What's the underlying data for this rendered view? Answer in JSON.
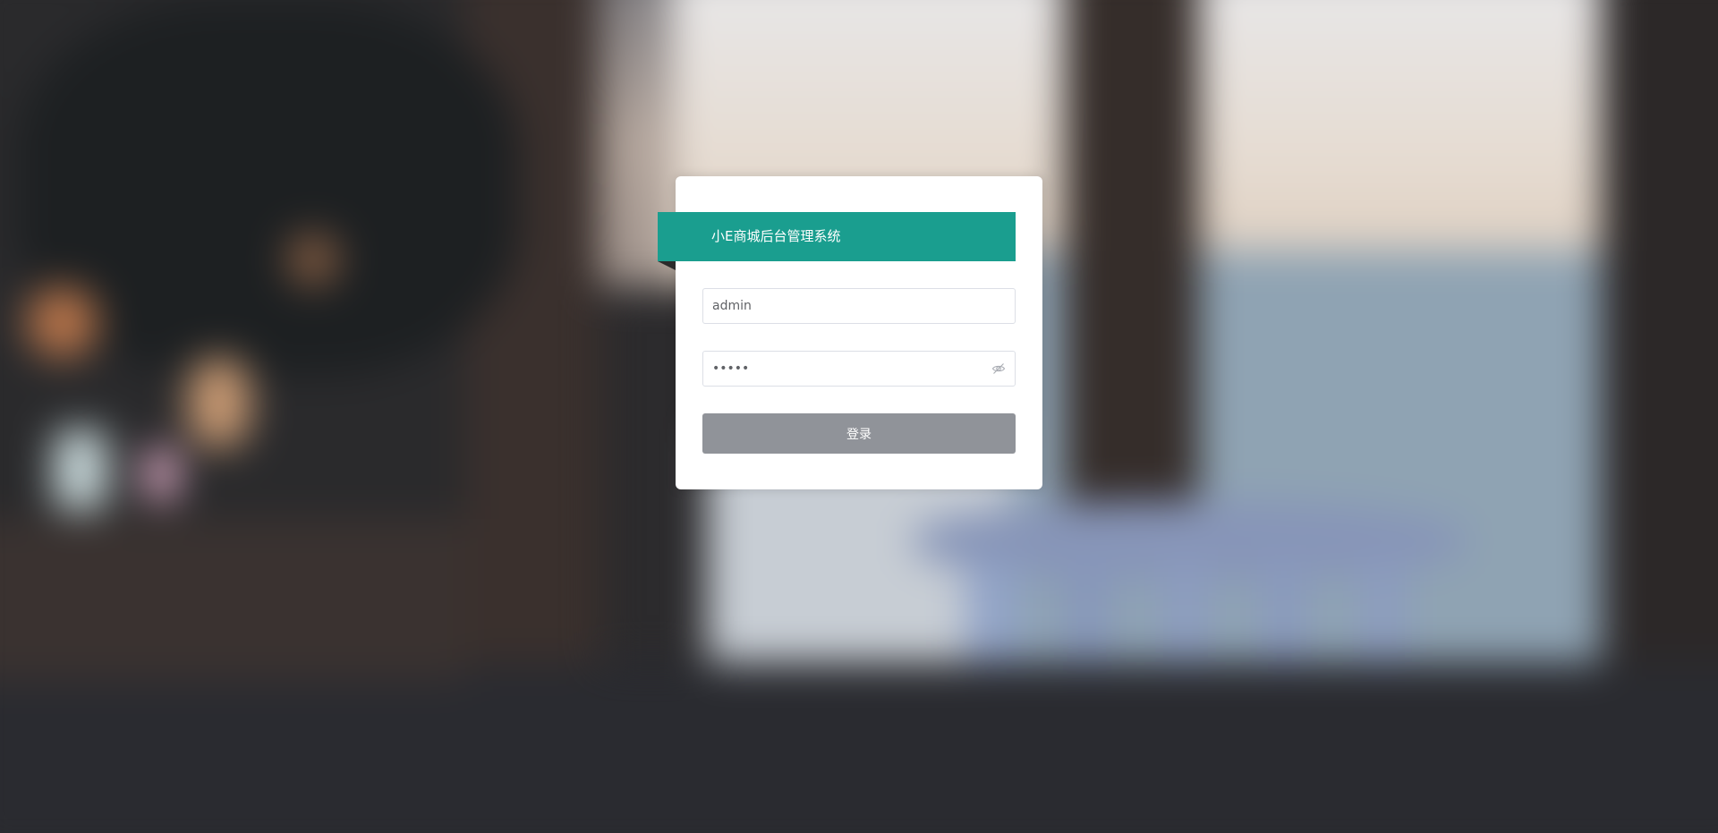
{
  "app": {
    "title": "小E商城后台管理系统"
  },
  "login": {
    "username_value": "admin",
    "password_value": "•••••",
    "submit_label": "登录"
  },
  "icons": {
    "password_toggle": "eye-off-icon"
  },
  "colors": {
    "accent": "#1a9e8f",
    "button_disabled": "#909399",
    "card_bg": "#ffffff"
  }
}
